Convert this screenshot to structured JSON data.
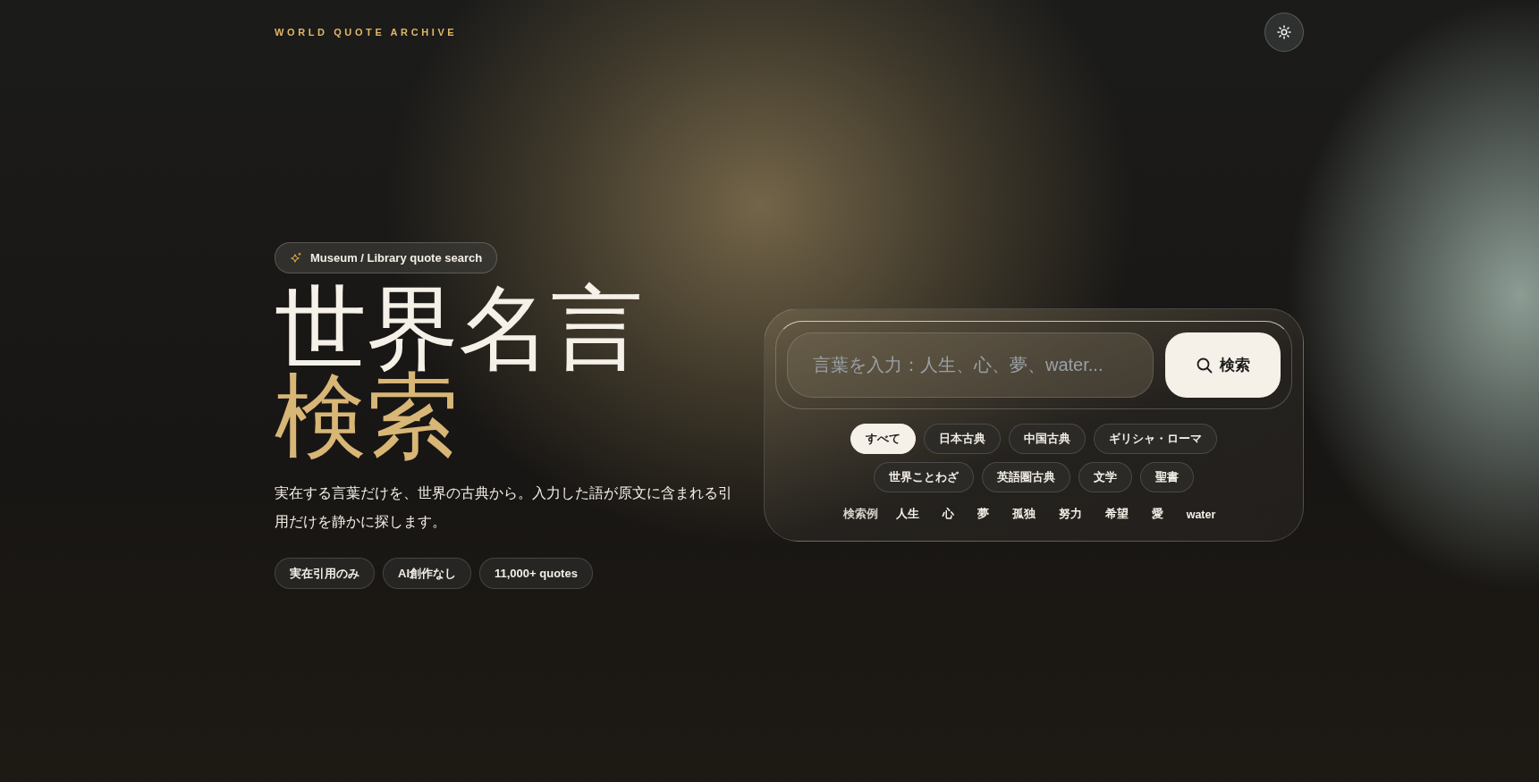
{
  "header": {
    "brand": "WORLD QUOTE ARCHIVE"
  },
  "hero": {
    "badge": "Museum / Library quote search",
    "title_line_1": "世界名言",
    "title_line_2": "検索",
    "description": "実在する言葉だけを、世界の古典から。入力した語が原文に含まれる引用だけを静かに探します。",
    "tags": [
      "実在引用のみ",
      "AI創作なし",
      "11,000+ quotes"
    ]
  },
  "search": {
    "placeholder": "言葉を入力：人生、心、夢、water...",
    "button": "検索",
    "categories": [
      {
        "label": "すべて",
        "selected": true
      },
      {
        "label": "日本古典",
        "selected": false
      },
      {
        "label": "中国古典",
        "selected": false
      },
      {
        "label": "ギリシャ・ローマ",
        "selected": false
      },
      {
        "label": "世界ことわざ",
        "selected": false
      },
      {
        "label": "英語圏古典",
        "selected": false
      },
      {
        "label": "文学",
        "selected": false
      },
      {
        "label": "聖書",
        "selected": false
      }
    ],
    "examples": {
      "label": "検索例",
      "terms": [
        "人生",
        "心",
        "夢",
        "孤独",
        "努力",
        "希望",
        "愛",
        "water"
      ]
    }
  }
}
